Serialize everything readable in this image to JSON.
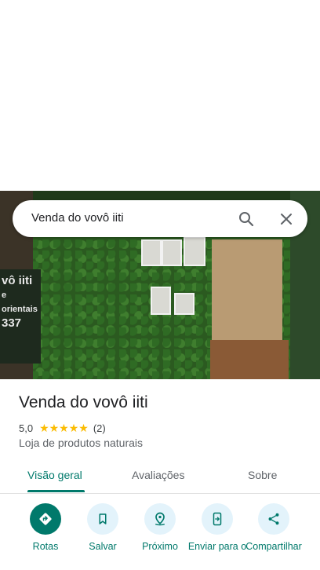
{
  "search": {
    "query": "Venda do vovô iiti"
  },
  "photo": {
    "sign_lines": [
      "vô iiti",
      "e orientais",
      "337"
    ]
  },
  "place": {
    "title": "Venda do vovô iiti",
    "rating": "5,0",
    "stars": "★★★★★",
    "review_count": "(2)",
    "category": "Loja de produtos naturais"
  },
  "tabs": [
    {
      "label": "Visão geral"
    },
    {
      "label": "Avaliações"
    },
    {
      "label": "Sobre"
    }
  ],
  "actions": [
    {
      "label": "Rotas",
      "icon": "directions-icon"
    },
    {
      "label": "Salvar",
      "icon": "bookmark-icon"
    },
    {
      "label": "Próximo",
      "icon": "nearby-icon"
    },
    {
      "label": "Enviar para o",
      "icon": "send-to-phone-icon"
    },
    {
      "label": "Compartilhar",
      "icon": "share-icon"
    }
  ],
  "colors": {
    "accent": "#00796b",
    "star": "#fbbc04",
    "action_bg": "#e3f3fb"
  }
}
